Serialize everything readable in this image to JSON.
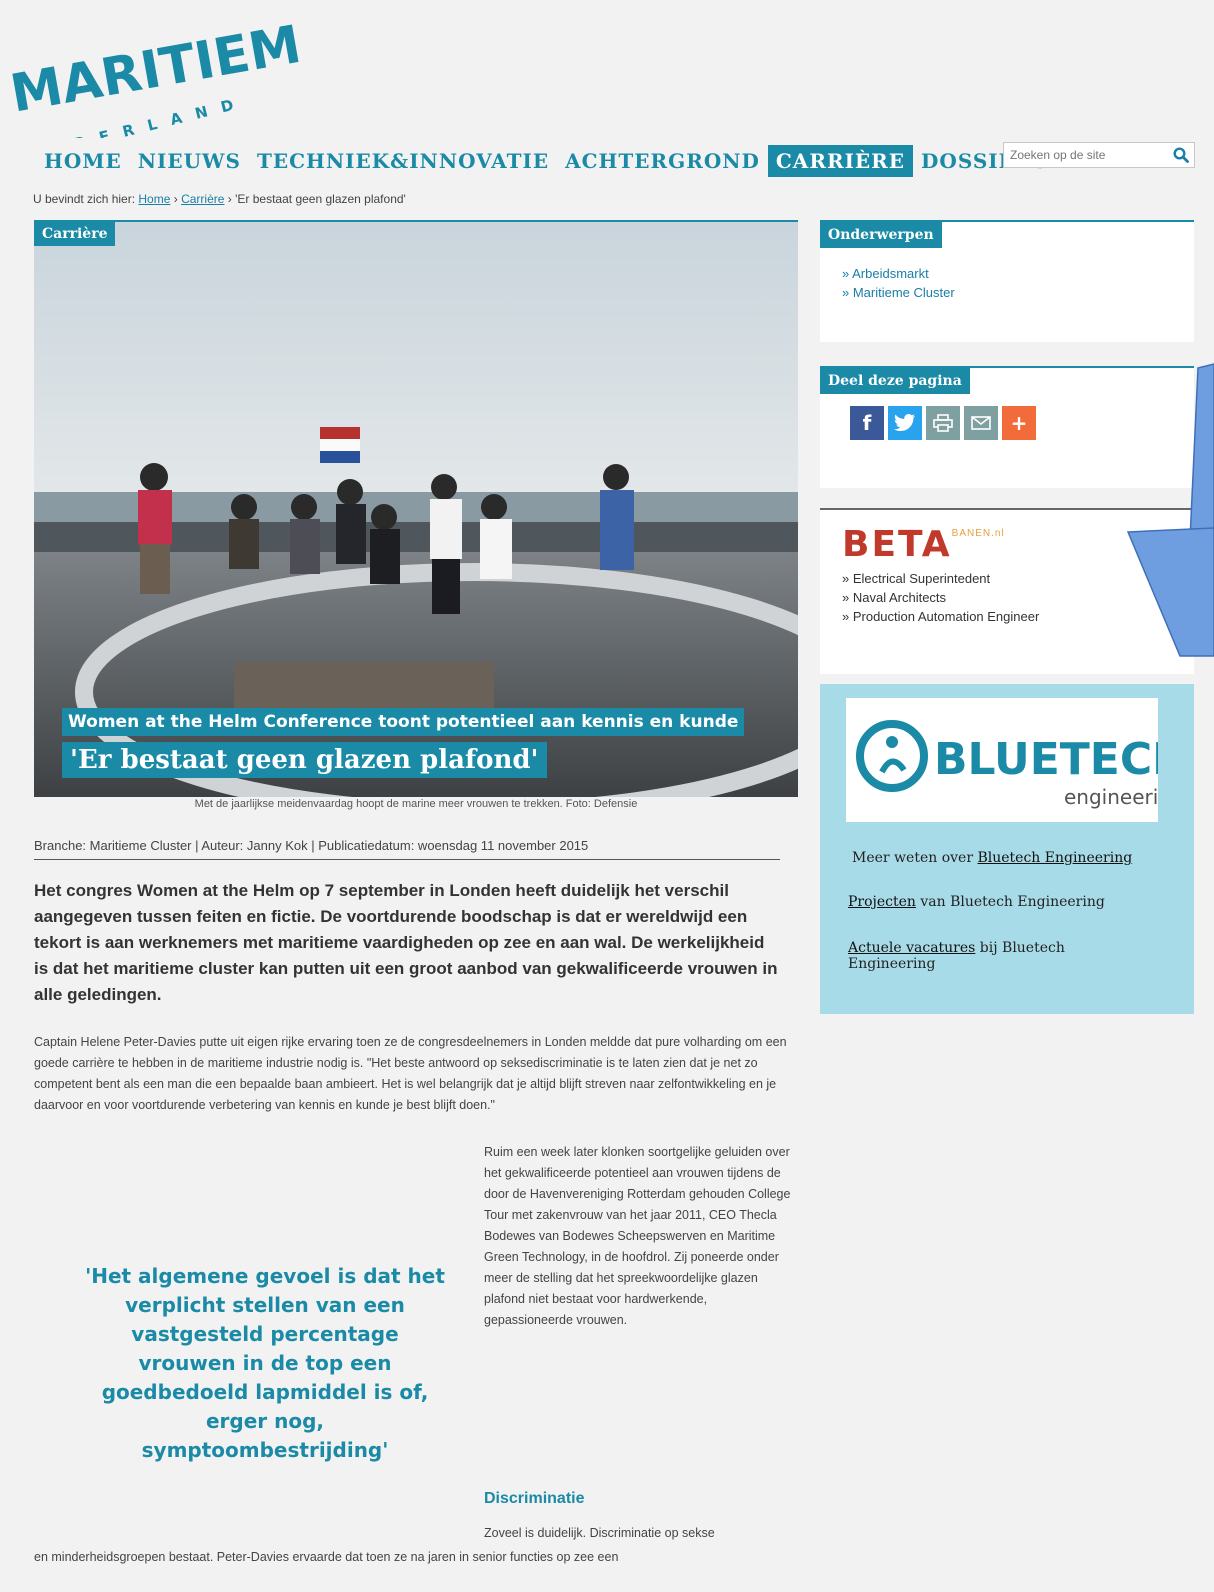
{
  "logo": {
    "line1": "MARITIEM",
    "line2": "NEDERLAND"
  },
  "nav": {
    "items": [
      "HOME",
      "NIEUWS",
      "TECHNIEK&INNOVATIE",
      "ACHTERGROND",
      "CARRIÈRE",
      "DOSSIERS"
    ],
    "active": "CARRIÈRE"
  },
  "search": {
    "placeholder": "Zoeken op de site"
  },
  "breadcrumb": {
    "prefix": "U bevindt zich hier:",
    "home": "Home",
    "section": "Carrière",
    "current": "'Er bestaat geen glazen plafond'",
    "sep": "›"
  },
  "hero": {
    "tag": "Carrière",
    "subtitle": "Women at the Helm Conference toont potentieel aan kennis en kunde",
    "title": "'Er bestaat geen glazen plafond'",
    "caption": "Met de jaarlijkse meidenvaardag hoopt de marine meer vrouwen te trekken. Foto: Defensie"
  },
  "meta": "Branche: Maritieme Cluster | Auteur: Janny Kok | Publicatiedatum: woensdag 11 november 2015",
  "article": {
    "lead": "Het congres Women at the Helm op 7 september in Londen heeft duidelijk het verschil aangegeven tussen feiten en fictie. De voortdurende boodschap is dat er wereldwijd een tekort is aan werknemers met maritieme vaardigheden op zee en aan wal. De werkelijkheid is dat het maritieme cluster kan putten uit een groot aanbod van gekwalificeerde vrouwen in alle geledingen.",
    "para1": "Captain Helene Peter-Davies putte uit eigen rijke ervaring toen ze de congresdeelnemers in Londen meldde dat pure volharding om een goede carrière te hebben in de maritieme industrie nodig is. \"Het beste antwoord op seksediscriminatie is te laten zien dat je net zo competent bent als een man die een bepaalde baan ambieert. Het is wel belangrijk dat je altijd blijft streven naar zelfontwikkeling en je daarvoor en voor voortdurende verbetering van kennis en kunde je best blijft doen.\"",
    "quote": "'Het algemene gevoel is dat het verplicht stellen van een vastgesteld percentage vrouwen in de top een goedbedoeld lapmiddel is of, erger nog, symptoombestrijding'",
    "para2": "Ruim een week later klonken soortgelijke geluiden over het gekwalificeerde potentieel aan vrouwen tijdens de door de Havenvereniging Rotterdam gehouden College Tour met zakenvrouw van het jaar 2011, CEO Thecla Bodewes van Bodewes Scheepswerven en Maritime Green Technology, in de hoofdrol. Zij poneerde onder meer de stelling dat het spreekwoordelijke glazen plafond niet bestaat voor hardwerkende, gepassioneerde vrouwen.",
    "heading": "Discriminatie",
    "para3a": "Zoveel is duidelijk. Discriminatie op sekse",
    "para3b": "en minderheidsgroepen bestaat. Peter-Davies ervaarde dat toen ze na jaren in senior functies op zee een"
  },
  "sidebar": {
    "topics": {
      "title": "Onderwerpen",
      "links": [
        "» Arbeidsmarkt",
        "» Maritieme Cluster"
      ]
    },
    "share": {
      "title": "Deel deze pagina",
      "icons": [
        "facebook-icon",
        "twitter-icon",
        "print-icon",
        "mail-icon",
        "plus-icon"
      ]
    },
    "beta": {
      "logo": "BETA",
      "logo_suffix": "BANEN.nl",
      "links": [
        "» Electrical Superintedent",
        "» Naval Architects",
        "» Production Automation Engineer"
      ]
    },
    "bluetech": {
      "logo_main": "BLUETECH",
      "logo_sub": "engineering",
      "line1_pre": "Meer weten over ",
      "line1_link": "Bluetech Engineering",
      "line2_link": "Projecten",
      "line2_post": "  van Bluetech Engineering",
      "line3_link": "Actuele vacatures",
      "line3_post": " bij Bluetech Engineering"
    }
  },
  "colors": {
    "accent": "#1a8aa6",
    "arrow": "#5b8fd6"
  }
}
